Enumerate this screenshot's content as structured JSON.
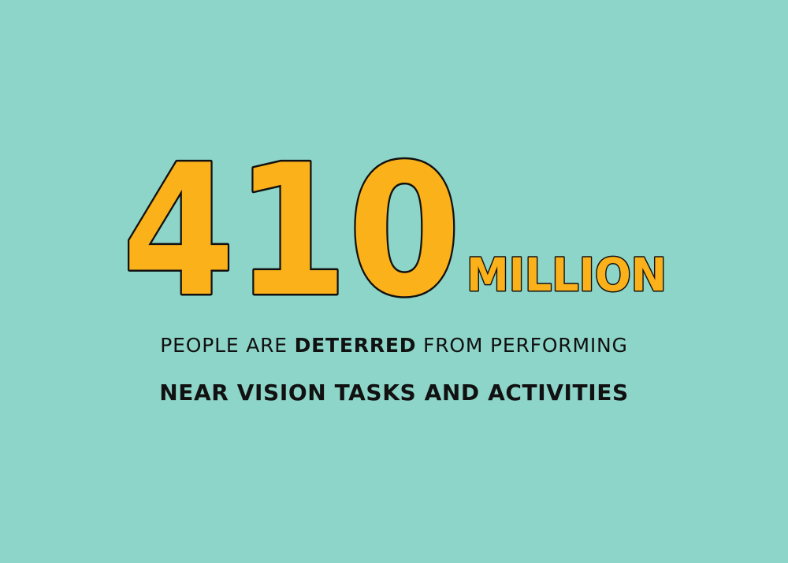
{
  "headline": {
    "number": "410",
    "unit": "MILLION"
  },
  "caption": {
    "line1_a": "PEOPLE ARE ",
    "line1_bold": "DETERRED",
    "line1_b": " FROM PERFORMING",
    "line2_a": "NEAR VISION ",
    "line2_b": "TASKS AND ACTIVITIES"
  },
  "colors": {
    "background": "#8dd5c8",
    "number_fill": "#fbb11a",
    "outline": "#111111",
    "text": "#111111"
  }
}
